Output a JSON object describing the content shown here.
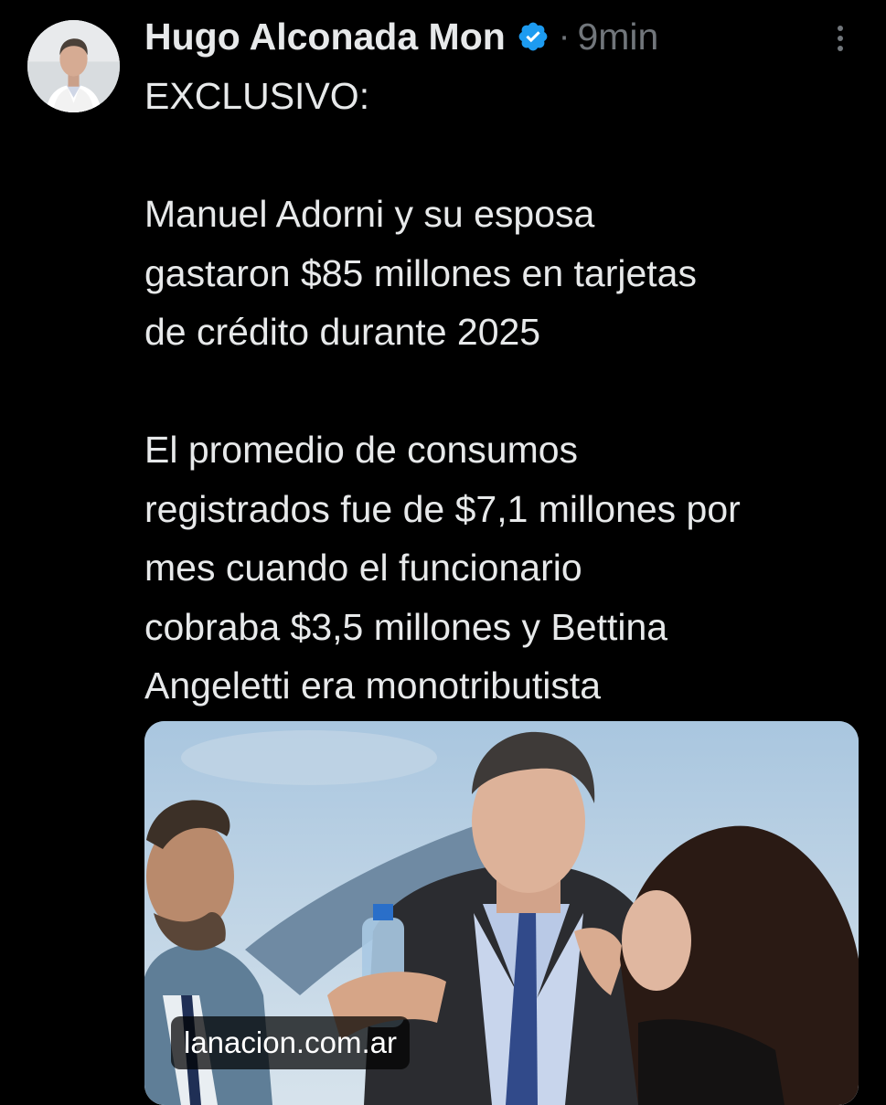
{
  "tweet": {
    "author": {
      "display_name": "Hugo Alconada Mon",
      "verified": true,
      "verified_icon": "verified-badge-icon",
      "avatar_icon": "avatar"
    },
    "separator": "·",
    "time": "9min",
    "more_icon": "more-options-icon",
    "text_lines": [
      "EXCLUSIVO:",
      "Manuel Adorni y su esposa",
      "gastaron $85 millones en tarjetas",
      "de crédito durante 2025",
      "El promedio de consumos",
      "registrados fue de $7,1 millones por",
      "mes cuando el funcionario",
      "cobraba $3,5 millones y Bettina",
      "Angeletti era monotributista"
    ],
    "media": {
      "source": "lanacion.com.ar"
    }
  },
  "colors": {
    "background": "#000000",
    "primary_text": "#e7e9ea",
    "secondary_text": "#71767b",
    "verified_blue": "#1d9bf0"
  }
}
